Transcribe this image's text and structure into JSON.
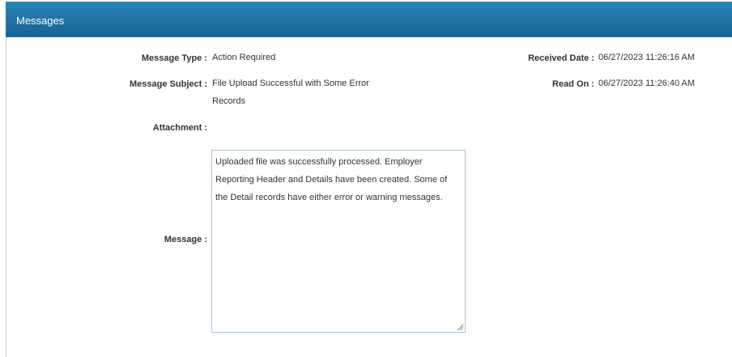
{
  "header": {
    "title": "Messages"
  },
  "fields": {
    "message_type": {
      "label": "Message Type :",
      "value": "Action Required"
    },
    "message_subject": {
      "label": "Message Subject :",
      "value_line1": "File Upload Successful with Some Error",
      "value_line2": "Records"
    },
    "attachment": {
      "label": "Attachment :",
      "value": ""
    },
    "message": {
      "label": "Message :",
      "line1": "Uploaded file was successfully processed. Employer",
      "line2": "Reporting Header and Details have been created. Some of",
      "line3": "the Detail records have either error or warning messages."
    },
    "received_date": {
      "label": "Received Date :",
      "value": "06/27/2023 11:26:16 AM"
    },
    "read_on": {
      "label": "Read On :",
      "value": "06/27/2023 11:26:40 AM"
    }
  },
  "colors": {
    "header_bg": "#1f6fa3",
    "textarea_border": "#a9c4d6"
  }
}
